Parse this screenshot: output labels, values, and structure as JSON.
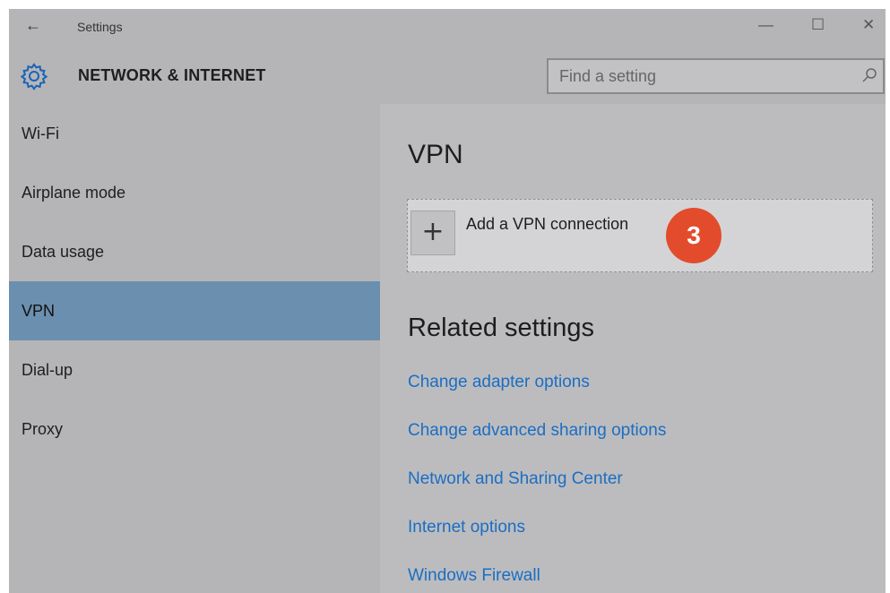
{
  "titlebar": {
    "back_icon": "back-arrow-icon",
    "title": "Settings",
    "minimize_icon": "minimize-icon",
    "maximize_icon": "maximize-icon",
    "close_icon": "close-icon"
  },
  "header": {
    "icon": "gear-icon",
    "title": "NETWORK & INTERNET",
    "search": {
      "placeholder": "Find a setting",
      "value": "",
      "icon": "search-icon"
    }
  },
  "sidebar": {
    "items": [
      {
        "label": "Wi-Fi"
      },
      {
        "label": "Airplane mode"
      },
      {
        "label": "Data usage"
      },
      {
        "label": "VPN",
        "selected": true
      },
      {
        "label": "Dial-up"
      },
      {
        "label": "Proxy"
      }
    ]
  },
  "main": {
    "title": "VPN",
    "add_vpn": {
      "icon": "plus-icon",
      "label": "Add a VPN connection"
    },
    "step_badge": "3",
    "related_title": "Related settings",
    "links": [
      {
        "label": "Change adapter options"
      },
      {
        "label": "Change advanced sharing options"
      },
      {
        "label": "Network and Sharing Center"
      },
      {
        "label": "Internet options"
      },
      {
        "label": "Windows Firewall"
      }
    ]
  },
  "colors": {
    "selected_nav": "#6b8faf",
    "link": "#1b6ec2",
    "badge": "#e24c2c",
    "window_bg": "#b8b8bb"
  }
}
